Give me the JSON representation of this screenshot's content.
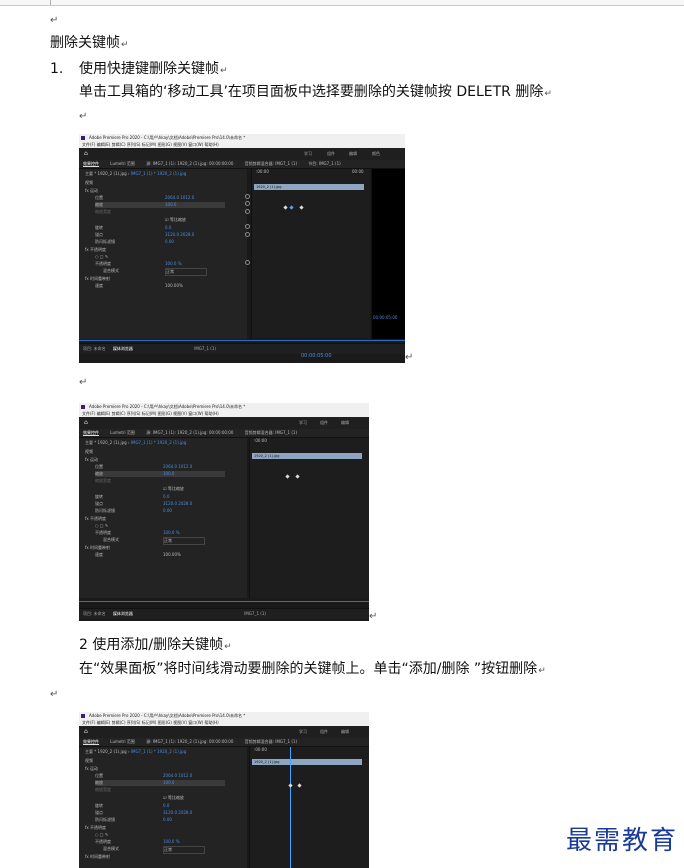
{
  "paragraph_mark": "↵",
  "heading": "删除关键帧",
  "item1": {
    "number": "1.",
    "title": "使用快捷键删除关键帧",
    "body": "单击工具箱的‘移动工具’在项目面板中选择要删除的关键帧按 DELETR 删除"
  },
  "item2": {
    "title": "2 使用添加/删除关键帧",
    "body": "在“效果面板”将时间线滑动要删除的关键帧上。单击“添加/删除 ”按钮删除"
  },
  "screenshot": {
    "app_title": "Adobe Premiere Pro 2020 - C:\\用户\\hkay\\文档\\Adobe\\Premiere Pro\\14.0\\未命名 *",
    "menu": "文件(F)  编辑(E)  剪辑(C)  序列(S)  标记(M)  图形(G)  视图(V)  窗口(W)  帮助(H)",
    "workspaces": [
      "学习",
      "组件",
      "编辑",
      "颜色"
    ],
    "tabs": [
      "效果控件",
      "Lumetri 范围",
      "源: IMG7_1 (1): 1920_2 (1).jpg: 00:00:00:00",
      "音频剪辑混合器: IMG7_1 (1)"
    ],
    "master": "主要 * 1920_2 (1).jpg",
    "clip_name": "1920_2 (1).jpg",
    "sequence": "IMG7_1 (1) * 1920_2 (1).jpg",
    "rows": [
      {
        "label": "视频",
        "value": ""
      },
      {
        "label": "fx 运动",
        "value": ""
      },
      {
        "label": "位置",
        "value": "2064.0   1012.0"
      },
      {
        "label": "缩放",
        "value": "100.0"
      },
      {
        "label": "缩放宽度",
        "value": "100.0"
      },
      {
        "label": "",
        "value": "☑ 等比缩放"
      },
      {
        "label": "旋转",
        "value": "0.0"
      },
      {
        "label": "锚点",
        "value": "3120.0   2028.0"
      },
      {
        "label": "防闪烁滤镜",
        "value": "0.00"
      },
      {
        "label": "fx 不透明度",
        "value": ""
      },
      {
        "label": "",
        "value": "○ □ ✎"
      },
      {
        "label": "不透明度",
        "value": "100.0 %"
      },
      {
        "label": "混合模式",
        "value": "正常"
      },
      {
        "label": "fx 时间重映射",
        "value": ""
      },
      {
        "label": "速度",
        "value": "100.00%"
      }
    ],
    "time_start": ":00:00",
    "time_end": "00:00",
    "timecode": "00:00:05:00",
    "project_tab": "项目: 未命名",
    "media_tab": "媒体浏览器",
    "timeline_tab": "IMG7_1 (1)",
    "program_tab": "节目: IMG7_1 (1)"
  },
  "watermark": "最需教育",
  "colors": {
    "link_blue": "#4a8de0",
    "clip": "#8fa6c3",
    "watermark": "#1a3a99"
  }
}
